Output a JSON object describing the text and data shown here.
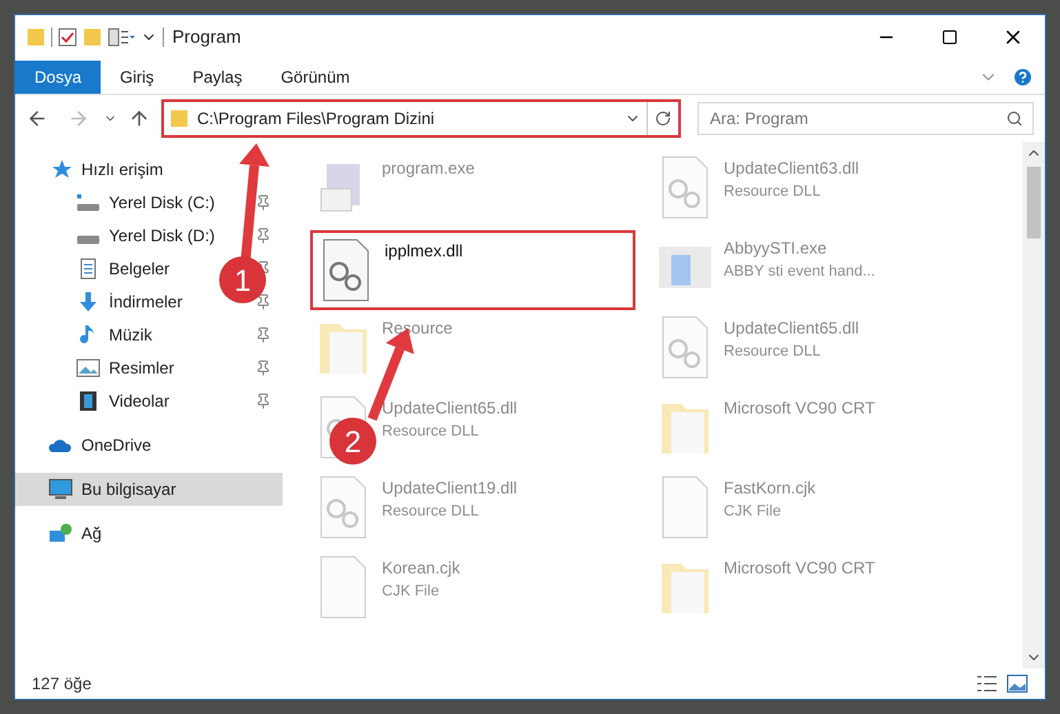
{
  "window": {
    "title": "Program"
  },
  "ribbon_tabs": [
    {
      "label": "Dosya",
      "kind": "file"
    },
    {
      "label": "Giriş",
      "kind": "tab"
    },
    {
      "label": "Paylaş",
      "kind": "tab"
    },
    {
      "label": "Görünüm",
      "kind": "tab"
    }
  ],
  "address": {
    "path": "C:\\Program Files\\Program Dizini",
    "highlighted": true
  },
  "search": {
    "placeholder": "Ara: Program"
  },
  "sidebar": [
    {
      "label": "Hızlı erişim",
      "kind": "star",
      "selected": false,
      "children": [
        {
          "label": "Yerel Disk (C:)",
          "kind": "drive-c",
          "pinned": true
        },
        {
          "label": "Yerel Disk (D:)",
          "kind": "drive",
          "pinned": true
        },
        {
          "label": "Belgeler",
          "kind": "docs",
          "pinned": true
        },
        {
          "label": "İndirmeler",
          "kind": "download",
          "pinned": true
        },
        {
          "label": "Müzik",
          "kind": "music",
          "pinned": true
        },
        {
          "label": "Resimler",
          "kind": "pictures",
          "pinned": true
        },
        {
          "label": "Videolar",
          "kind": "videos",
          "pinned": true
        }
      ]
    },
    {
      "label": "OneDrive",
      "kind": "cloud",
      "selected": false
    },
    {
      "label": "Bu bilgisayar",
      "kind": "pc",
      "selected": true
    },
    {
      "label": "Ağ",
      "kind": "network",
      "selected": false
    }
  ],
  "files": [
    {
      "name": "program.exe",
      "kind": "exe",
      "faded": true,
      "highlighted": false
    },
    {
      "name": "UpdateClient63.dll",
      "subtitle": "Resource DLL",
      "kind": "dll",
      "faded": true,
      "highlighted": false
    },
    {
      "name": "ipplmex.dll",
      "kind": "dll",
      "faded": false,
      "highlighted": true
    },
    {
      "name": "AbbyySTI.exe",
      "subtitle": "ABBY sti event hand...",
      "kind": "app",
      "faded": true,
      "highlighted": false
    },
    {
      "name": "Resource",
      "kind": "folder",
      "faded": true,
      "highlighted": false
    },
    {
      "name": "UpdateClient65.dll",
      "subtitle": "Resource DLL",
      "kind": "dll",
      "faded": true,
      "highlighted": false
    },
    {
      "name": "UpdateClient65.dll",
      "subtitle": "Resource DLL",
      "kind": "dll",
      "faded": true,
      "highlighted": false
    },
    {
      "name": "Microsoft VC90 CRT",
      "kind": "folder",
      "faded": true,
      "highlighted": false
    },
    {
      "name": "UpdateClient19.dll",
      "subtitle": "Resource DLL",
      "kind": "dll",
      "faded": true,
      "highlighted": false
    },
    {
      "name": "FastKorn.cjk",
      "subtitle": "CJK File",
      "kind": "cjk",
      "faded": true,
      "highlighted": false
    },
    {
      "name": "Korean.cjk",
      "subtitle": "CJK File",
      "kind": "cjk",
      "faded": true,
      "highlighted": false
    },
    {
      "name": "Microsoft VC90 CRT",
      "kind": "folder",
      "faded": true,
      "highlighted": false
    }
  ],
  "status_bar": {
    "count": "127 öğe"
  },
  "callouts": [
    {
      "number": "1"
    },
    {
      "number": "2"
    }
  ]
}
